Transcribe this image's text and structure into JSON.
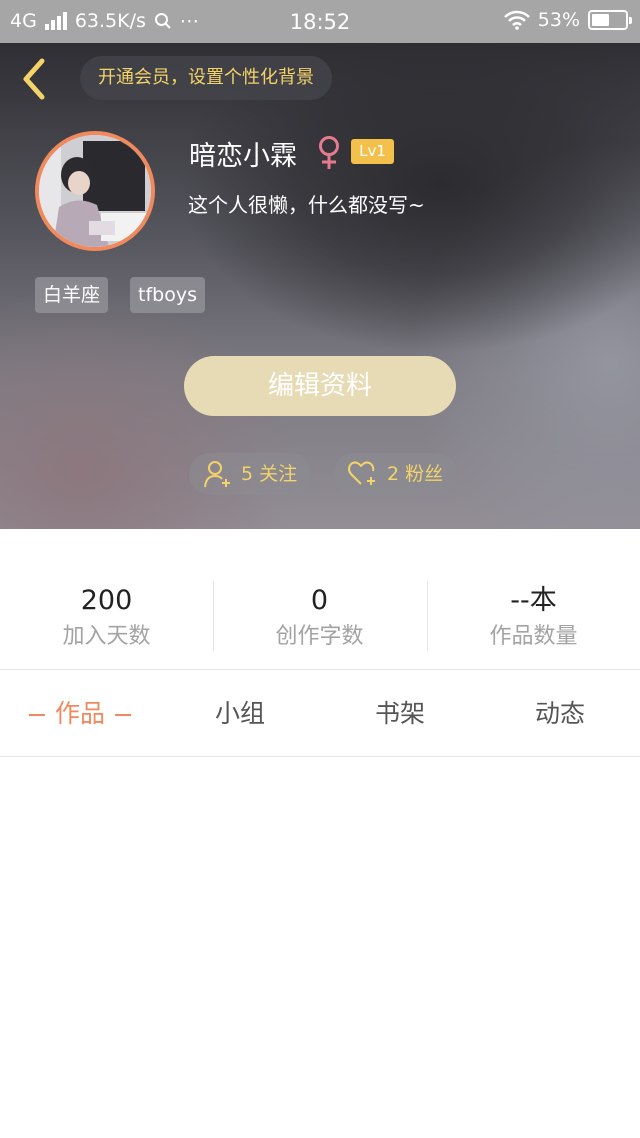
{
  "status_bar": {
    "network": "4G",
    "speed": "63.5K/s",
    "extras": "⋯",
    "time": "18:52",
    "battery_text": "53%",
    "battery_level": 0.53,
    "icons": [
      "signal-icon",
      "search-icon",
      "wifi-icon",
      "battery-icon"
    ]
  },
  "header": {
    "back_icon": "chevron-left-icon",
    "vip_prompt": "开通会员，设置个性化背景",
    "username": "暗恋小霖",
    "gender_icon": "female-icon",
    "level": "Lv1",
    "signature": "这个人很懒，什么都没写~",
    "tags": [
      "白羊座",
      "tfboys"
    ],
    "edit_label": "编辑资料",
    "follow": {
      "icon": "add-user-icon",
      "label": "5 关注"
    },
    "fans": {
      "icon": "heart-icon",
      "label": "2 粉丝"
    }
  },
  "stats": [
    {
      "value": "200",
      "label": "加入天数"
    },
    {
      "value": "0",
      "label": "创作字数"
    },
    {
      "value": "--本",
      "label": "作品数量"
    }
  ],
  "tabs": [
    {
      "label": "作品",
      "active": true
    },
    {
      "label": "小组",
      "active": false
    },
    {
      "label": "书架",
      "active": false
    },
    {
      "label": "动态",
      "active": false
    }
  ],
  "colors": {
    "accent": "#f08a5d",
    "gold": "#f3d36a",
    "level_badge": "#f3c04b",
    "edit_button": "#e7dbb6",
    "female": "#e57b90"
  }
}
